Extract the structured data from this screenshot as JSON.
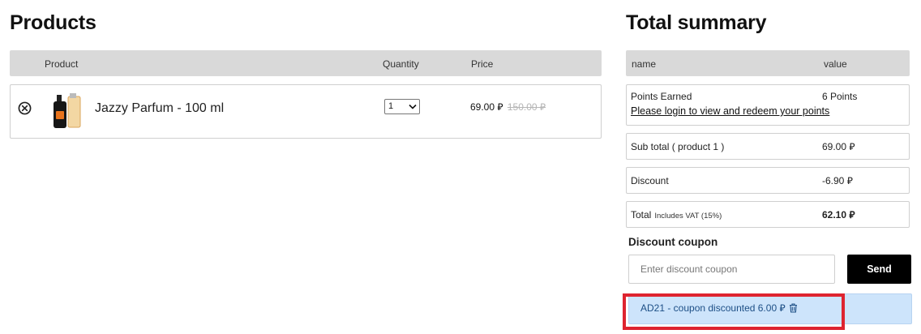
{
  "products_section": {
    "title": "Products",
    "headers": {
      "product": "Product",
      "quantity": "Quantity",
      "price": "Price"
    },
    "items": [
      {
        "name": "Jazzy Parfum - 100 ml",
        "quantity": "1",
        "price": "69.00",
        "old_price": "150.00",
        "currency_icon": "saudi-riyal-sign",
        "thumbnail_icon": "perfume-bottle"
      }
    ]
  },
  "summary": {
    "title": "Total summary",
    "headers": {
      "name": "name",
      "value": "value"
    },
    "points": {
      "label": "Points Earned",
      "value": "6 Points",
      "login_link": "Please login to view and redeem your points"
    },
    "subtotal": {
      "label": "Sub total ( product 1 )",
      "value": "69.00"
    },
    "discount": {
      "label": "Discount",
      "value": "-6.90"
    },
    "total": {
      "label": "Total",
      "note": "Includes VAT (15%)",
      "value": "62.10"
    }
  },
  "coupon": {
    "title": "Discount coupon",
    "placeholder": "Enter discount coupon",
    "send_label": "Send",
    "applied_text": "AD21 - coupon discounted 6.00"
  },
  "colors": {
    "header_bg": "#d9d9d9",
    "send_button": "#000000",
    "applied_bg": "#cde4fb",
    "applied_text": "#1d4f86",
    "highlight": "#de2430"
  }
}
